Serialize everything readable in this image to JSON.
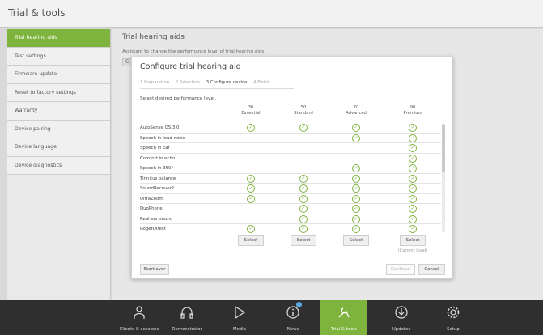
{
  "window": {
    "title": "Trial & tools"
  },
  "sidebar": {
    "items": [
      {
        "label": "Trial hearing aids",
        "active": true
      },
      {
        "label": "Test settings"
      },
      {
        "label": "Firmware update"
      },
      {
        "label": "Reset to factory settings"
      },
      {
        "label": "Warranty"
      },
      {
        "label": "Device pairing"
      },
      {
        "label": "Device language"
      },
      {
        "label": "Device diagnostics"
      }
    ]
  },
  "main": {
    "heading": "Trial hearing aids",
    "description": "Assistant to change the performance level of trial hearing aids.",
    "stub_label": "C"
  },
  "dialog": {
    "title": "Configure trial hearing aid",
    "steps": [
      "1 Preparation",
      "2 Selection",
      "3 Configure device",
      "4 Finish"
    ],
    "current_step": 2,
    "instruction": "Select desired performance level.",
    "columns": [
      {
        "level": "30",
        "name": "Essential"
      },
      {
        "level": "50",
        "name": "Standard"
      },
      {
        "level": "70",
        "name": "Advanced"
      },
      {
        "level": "90",
        "name": "Premium"
      }
    ],
    "features": [
      {
        "name": "AutoSense OS 3.0",
        "levels": [
          true,
          true,
          true,
          true
        ]
      },
      {
        "name": "Speech in loud noise",
        "levels": [
          false,
          false,
          true,
          true
        ]
      },
      {
        "name": "Speech in car",
        "levels": [
          false,
          false,
          false,
          true
        ]
      },
      {
        "name": "Comfort in echo",
        "levels": [
          false,
          false,
          false,
          true
        ]
      },
      {
        "name": "Speech in 360°",
        "levels": [
          false,
          false,
          true,
          true
        ]
      },
      {
        "name": "Tinnitus balance",
        "levels": [
          true,
          true,
          true,
          true
        ]
      },
      {
        "name": "SoundRecover2",
        "levels": [
          true,
          true,
          true,
          true
        ]
      },
      {
        "name": "UltraZoom",
        "levels": [
          true,
          true,
          true,
          true
        ]
      },
      {
        "name": "DuoPhone",
        "levels": [
          false,
          true,
          true,
          true
        ]
      },
      {
        "name": "Real ear sound",
        "levels": [
          false,
          true,
          true,
          true
        ]
      },
      {
        "name": "RogerDirect",
        "levels": [
          true,
          true,
          true,
          true
        ]
      }
    ],
    "select_label": "Select",
    "current_level_label": "(Current level)",
    "current_level_index": 3,
    "start_over_label": "Start over",
    "continue_label": "Continue",
    "cancel_label": "Cancel"
  },
  "bottom_nav": {
    "items": [
      {
        "label": "Clients & sessions",
        "icon": "person-icon"
      },
      {
        "label": "Demonstrator",
        "icon": "headphones-icon"
      },
      {
        "label": "Media",
        "icon": "play-icon"
      },
      {
        "label": "News",
        "icon": "info-icon"
      },
      {
        "label": "Trial & tools",
        "icon": "tools-icon",
        "active": true
      },
      {
        "label": "Updates",
        "icon": "download-icon"
      },
      {
        "label": "Setup",
        "icon": "gear-icon"
      }
    ]
  },
  "colors": {
    "accent": "#7eb33e",
    "badge": "#5aa9e0",
    "bottom_bar": "#2f2f2f"
  }
}
